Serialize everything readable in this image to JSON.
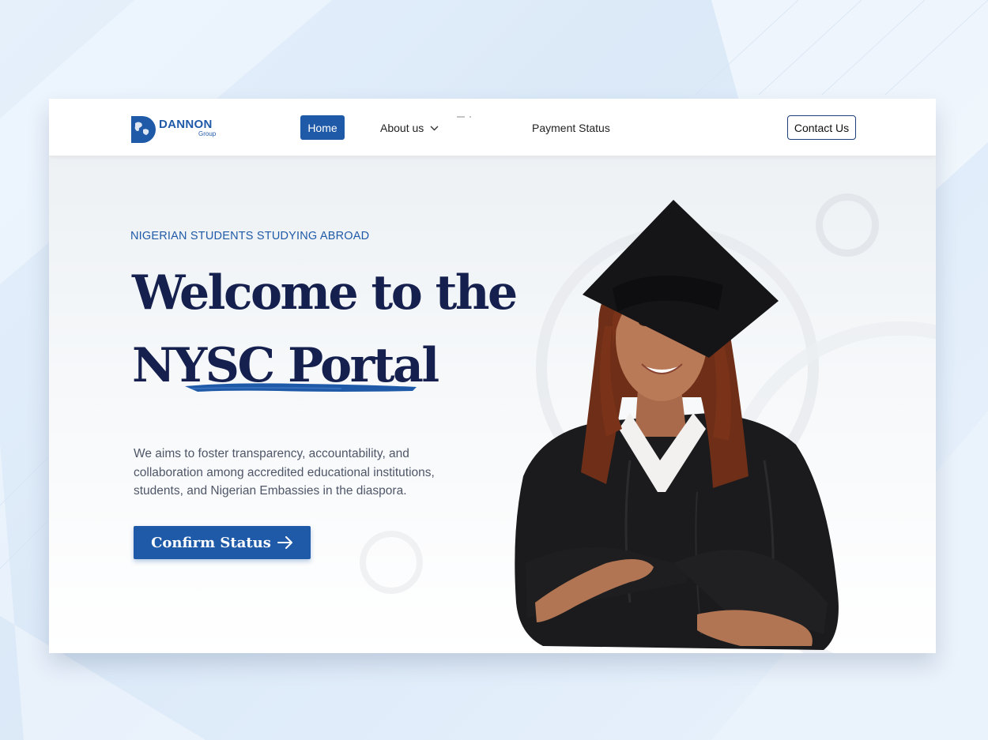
{
  "brand": {
    "name": "DANNON",
    "sub": "Group",
    "color": "#1f5aa8"
  },
  "nav": {
    "home": "Home",
    "about": "About us",
    "payment": "Payment Status",
    "contact": "Contact Us"
  },
  "hero": {
    "eyebrow": "NIGERIAN STUDENTS STUDYING ABROAD",
    "title_line1": "Welcome to the",
    "title_line2": "NYSC Portal",
    "description": "We aims to foster transparency, accountability, and collaboration among accredited educational institutions, students, and Nigerian Embassies in the diaspora.",
    "cta": "Confirm Status"
  },
  "colors": {
    "primary": "#1f5aa8",
    "heading": "#15204e",
    "background": "#e6f0fb"
  },
  "icons": {
    "about_dropdown": "chevron-down-icon",
    "cta": "arrow-right-icon",
    "logo": "globe-d-icon"
  }
}
